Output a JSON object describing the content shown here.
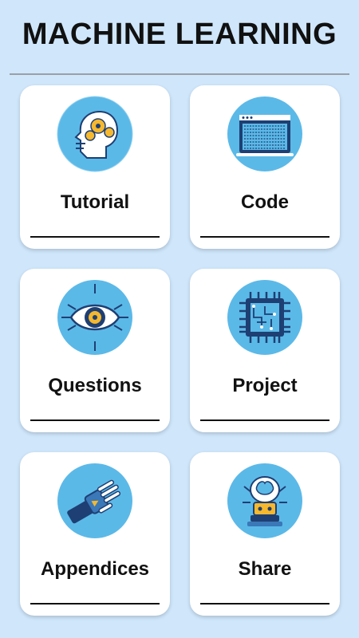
{
  "app": {
    "title": "MACHINE LEARNING"
  },
  "menu": [
    {
      "label": "Tutorial",
      "icon": "ai-head-gears-icon"
    },
    {
      "label": "Code",
      "icon": "code-window-icon"
    },
    {
      "label": "Questions",
      "icon": "circuit-eye-icon"
    },
    {
      "label": "Project",
      "icon": "cpu-chip-icon"
    },
    {
      "label": "Appendices",
      "icon": "robot-hand-icon"
    },
    {
      "label": "Share",
      "icon": "robot-brain-icon"
    }
  ],
  "colors": {
    "background": "#cfe6fb",
    "icon_circle": "#5bb9e8",
    "icon_dark": "#1e3f73",
    "accent_yellow": "#f5b82e"
  }
}
